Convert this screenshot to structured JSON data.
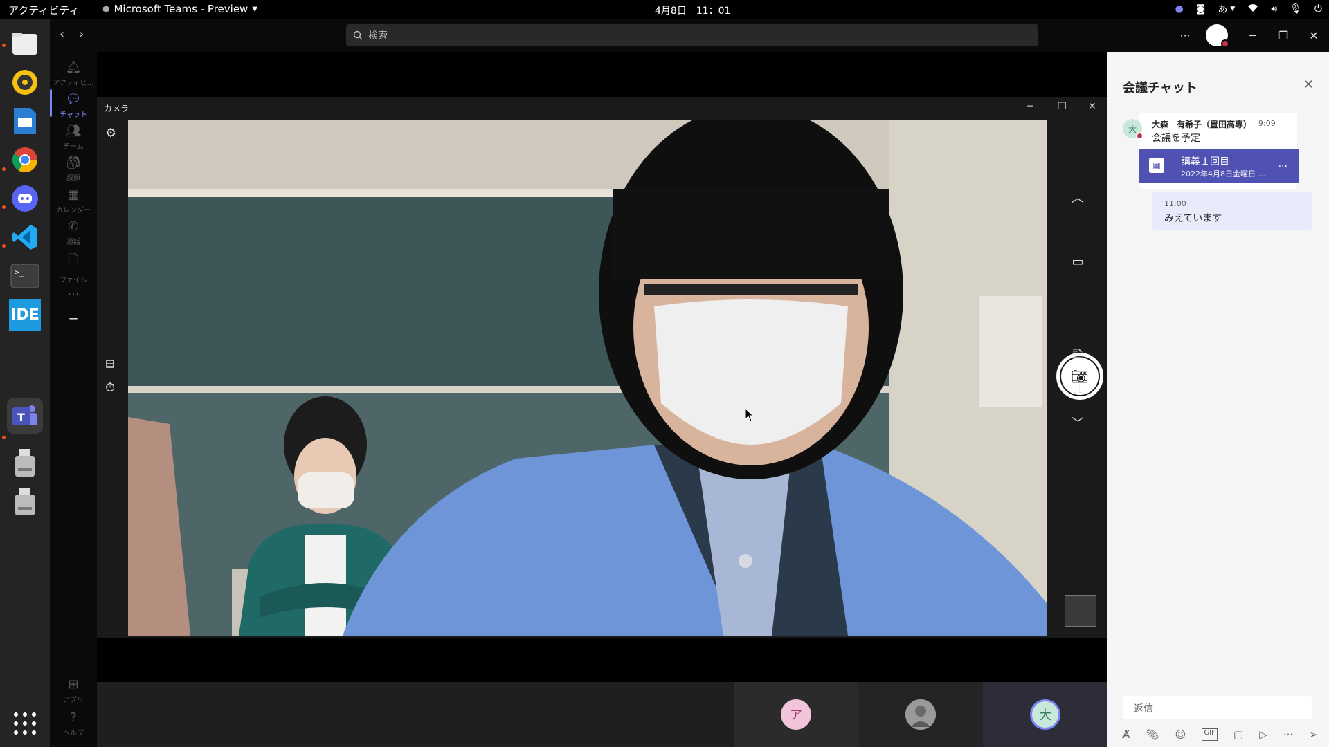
{
  "system": {
    "activities": "アクティビティ",
    "app_name": "Microsoft Teams - Preview",
    "clock": "4月8日　11：01",
    "ime": "あ"
  },
  "dock": {
    "items": [
      "files",
      "rhythmbox",
      "libreoffice-impress",
      "chrome",
      "discord",
      "vscode",
      "terminal",
      "intellij-idea",
      "teams",
      "usb-drive",
      "usb-drive"
    ],
    "ide_label": "IDE"
  },
  "teams": {
    "search_placeholder": "検索",
    "rail": [
      {
        "label": "アクティビ…",
        "icon": "bell-icon"
      },
      {
        "label": "チャット",
        "icon": "chat-icon"
      },
      {
        "label": "チーム",
        "icon": "teams-icon"
      },
      {
        "label": "課題",
        "icon": "assignments-icon"
      },
      {
        "label": "カレンダー",
        "icon": "calendar-icon"
      },
      {
        "label": "通話",
        "icon": "phone-icon"
      },
      {
        "label": "ファイル",
        "icon": "file-icon"
      }
    ],
    "rail_bottom": [
      {
        "label": "アプリ",
        "icon": "apps-icon"
      },
      {
        "label": "ヘルプ",
        "icon": "help-icon"
      }
    ]
  },
  "camera": {
    "title": "カメラ"
  },
  "participants": [
    {
      "initial": "ア",
      "color": "#f2c4d9"
    },
    {
      "initial": "",
      "color": "#b9b9b9"
    },
    {
      "initial": "大",
      "color": "#c8e8dc"
    }
  ],
  "chat": {
    "title": "会議チャット",
    "message": {
      "sender": "大森　有希子（豊田高専）",
      "time": "9:09",
      "avatar_initial": "大",
      "text": "会議を予定",
      "card_title": "講義１回目",
      "card_date": "2022年4月8日金曜日 ...",
      "card_more": "..."
    },
    "reply": {
      "time": "11:00",
      "text": "みえています"
    },
    "reply_placeholder": "返信"
  }
}
